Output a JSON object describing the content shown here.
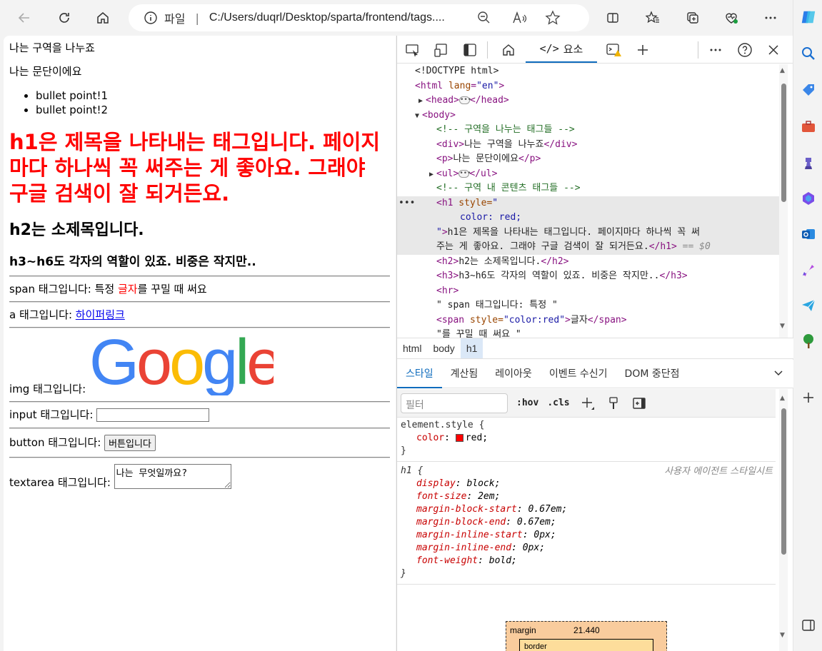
{
  "browser": {
    "address_scheme": "파일",
    "address_sep": "|",
    "url": "C:/Users/duqrl/Desktop/sparta/frontend/tags....",
    "icons": [
      "back-icon",
      "refresh-icon",
      "home-icon",
      "info-icon",
      "zoom-out-icon",
      "read-aloud-icon",
      "favorite-star-icon",
      "split-screen-icon",
      "favorites-icon",
      "collections-icon",
      "browser-essentials-icon",
      "more-icon",
      "copilot-icon"
    ]
  },
  "page": {
    "div_text": "나는 구역을 나누죠",
    "p_text": "나는 문단이에요",
    "bullets": [
      "bullet point!1",
      "bullet point!2"
    ],
    "h1": "h1은 제목을 나타내는 태그입니다. 페이지마다 하나씩 꼭 써주는 게 좋아요. 그래야 구글 검색이 잘 되거든요.",
    "h2": "h2는 소제목입니다.",
    "h3": "h3~h6도 각자의 역할이 있죠. 비중은 작지만..",
    "span_prefix": "span 태그입니다: 특정 ",
    "span_red": "글자",
    "span_suffix": "를 꾸밀 때 써요",
    "a_prefix": "a 태그입니다: ",
    "a_link": "하이퍼링크",
    "img_label": "img 태그입니다:",
    "google_logo": "Google",
    "input_label": "input 태그입니다:",
    "button_label": "button 태그입니다:",
    "button_text": "버튼입니다",
    "textarea_label": "textarea 태그입니다:",
    "textarea_value": "나는 무엇일까요?"
  },
  "devtools": {
    "tab_elements": "요소",
    "dom": {
      "doctype": "<!DOCTYPE html>",
      "html_open_tag": "<html",
      "html_attr": "lang",
      "html_attr_val": "\"en\"",
      "head_open": "<head>",
      "head_close": "</head>",
      "body_open": "<body>",
      "comment1": "<!-- 구역을 나누는 태그들 -->",
      "div_open": "<div>",
      "div_text": "나는 구역을 나누죠",
      "div_close": "</div>",
      "p_open": "<p>",
      "p_text": "나는 문단이에요",
      "p_close": "</p>",
      "ul_open": "<ul>",
      "ul_close": "</ul>",
      "comment2": "<!-- 구역 내 콘텐츠 태그들 -->",
      "h1_tag": "<h1",
      "h1_attr": " style=",
      "h1_attr_open": "\"",
      "h1_style": "color: red;",
      "h1_attr_close": "\"",
      "h1_gt": ">",
      "h1_text_1": "h1은 제목을 나타내는 태그입니다. 페이지마다 하나씩 꼭 써",
      "h1_text_2": "주는 게 좋아요. 그래야 구글 검색이 잘 되거든요.",
      "h1_close": "</h1>",
      "eq_dollar": " == $0",
      "h2_open": "<h2>",
      "h2_text": "h2는 소제목입니다.",
      "h2_close": "</h2>",
      "h3_open": "<h3>",
      "h3_text": "h3~h6도 각자의 역할이 있죠. 비중은 작지만..",
      "h3_close": "</h3>",
      "hr": "<hr>",
      "text_span": "\" span 태그입니다: 특정 \"",
      "span_open_tag": "<span",
      "span_attr": " style=",
      "span_attr_val": "\"color:red\"",
      "span_gt": ">",
      "span_text": "글자",
      "span_close": "</span>",
      "text_after": "\"를 꾸밀 때 써요 \""
    },
    "breadcrumbs": [
      "html",
      "body",
      "h1"
    ],
    "style_tabs": [
      "스타일",
      "계산됨",
      "레이아웃",
      "이벤트 수신기",
      "DOM 중단점"
    ],
    "filter_placeholder": "필터",
    "hov": ":hov",
    "cls": ".cls",
    "element_style": {
      "selector": "element.style {",
      "prop": "color",
      "val": "red;",
      "close": "}"
    },
    "ua_rule": {
      "selector": "h1 {",
      "source": "사용자 에이전트 스타일시트",
      "close": "}",
      "props": [
        {
          "name": "display",
          "value": "block;"
        },
        {
          "name": "font-size",
          "value": "2em;"
        },
        {
          "name": "margin-block-start",
          "value": "0.67em;"
        },
        {
          "name": "margin-block-end",
          "value": "0.67em;"
        },
        {
          "name": "margin-inline-start",
          "value": "0px;"
        },
        {
          "name": "margin-inline-end",
          "value": "0px;"
        },
        {
          "name": "font-weight",
          "value": "bold;"
        }
      ]
    },
    "box_model": {
      "label": "margin",
      "value": "21.440",
      "inner_label": "border"
    }
  },
  "colors": {
    "accent": "#0f6cbd",
    "h1": "#ff0000"
  }
}
